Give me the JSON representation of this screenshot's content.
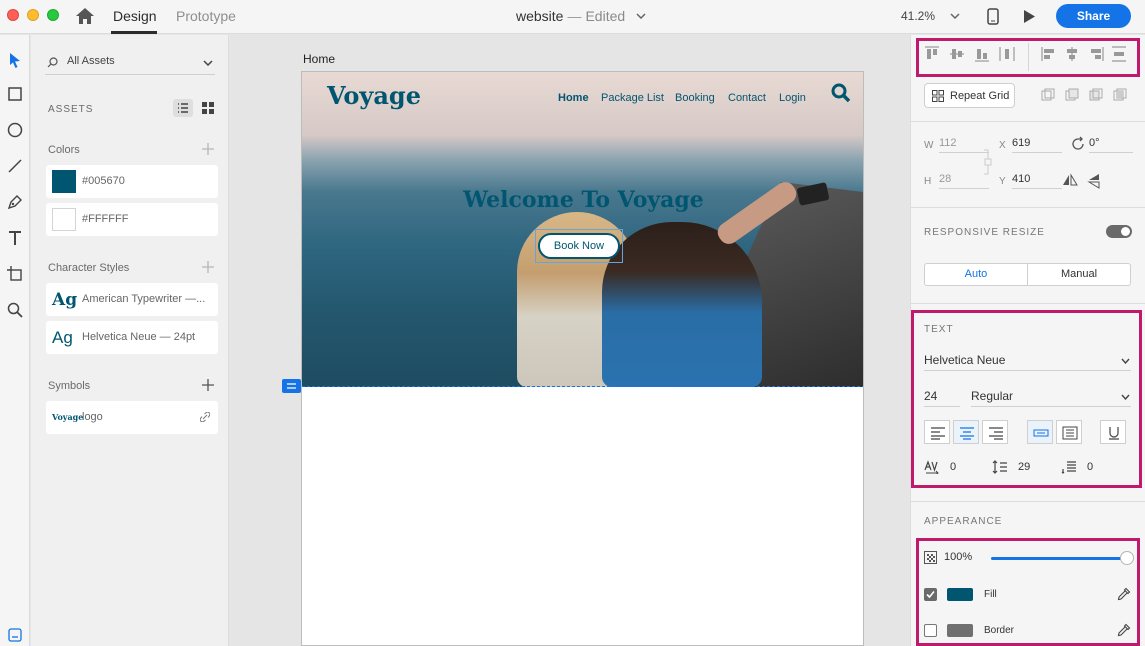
{
  "titlebar": {
    "tabs": [
      "Design",
      "Prototype"
    ],
    "doc_name": "website",
    "doc_separator": "—",
    "doc_status": "Edited",
    "zoom": "41.2%",
    "share_label": "Share"
  },
  "assets": {
    "search_label": "All Assets",
    "heading": "ASSETS",
    "colors_heading": "Colors",
    "colors": [
      {
        "label": "#005670",
        "hex": "#005670"
      },
      {
        "label": "#FFFFFF",
        "hex": "#FFFFFF"
      }
    ],
    "char_styles_heading": "Character Styles",
    "char_styles": [
      {
        "glyph": "Ag",
        "label": "American Typewriter —..."
      },
      {
        "glyph": "Ag",
        "label": "Helvetica Neue — 24pt"
      }
    ],
    "symbols_heading": "Symbols",
    "symbols": [
      {
        "thumb": "Voyage",
        "label": "logo"
      }
    ]
  },
  "canvas": {
    "artboard_name": "Home",
    "site": {
      "logo": "Voyage",
      "nav": [
        "Home",
        "Package List",
        "Booking",
        "Contact",
        "Login"
      ],
      "active_nav": "Home",
      "headline": "Welcome To Voyage",
      "cta": "Book Now",
      "brand_color": "#005670"
    }
  },
  "properties": {
    "repeat_grid_label": "Repeat Grid",
    "geometry": {
      "w_label": "W",
      "w": "112",
      "h_label": "H",
      "h": "28",
      "x_label": "X",
      "x": "619",
      "y_label": "Y",
      "y": "410",
      "rotation": "0°"
    },
    "responsive_resize_title": "RESPONSIVE RESIZE",
    "responsive_resize_on": true,
    "resize_modes": [
      "Auto",
      "Manual"
    ],
    "text_title": "TEXT",
    "font_family": "Helvetica Neue",
    "font_size": "24",
    "font_weight": "Regular",
    "char_spacing": "0",
    "line_spacing": "29",
    "para_spacing": "0",
    "appearance_title": "APPEARANCE",
    "opacity": "100%",
    "opacity_fraction": 1.0,
    "fill_label": "Fill",
    "fill_color": "#005670",
    "fill_checked": true,
    "border_label": "Border",
    "border_color": "#707070",
    "border_checked": false,
    "highlight_color": "#BF1A6E"
  }
}
